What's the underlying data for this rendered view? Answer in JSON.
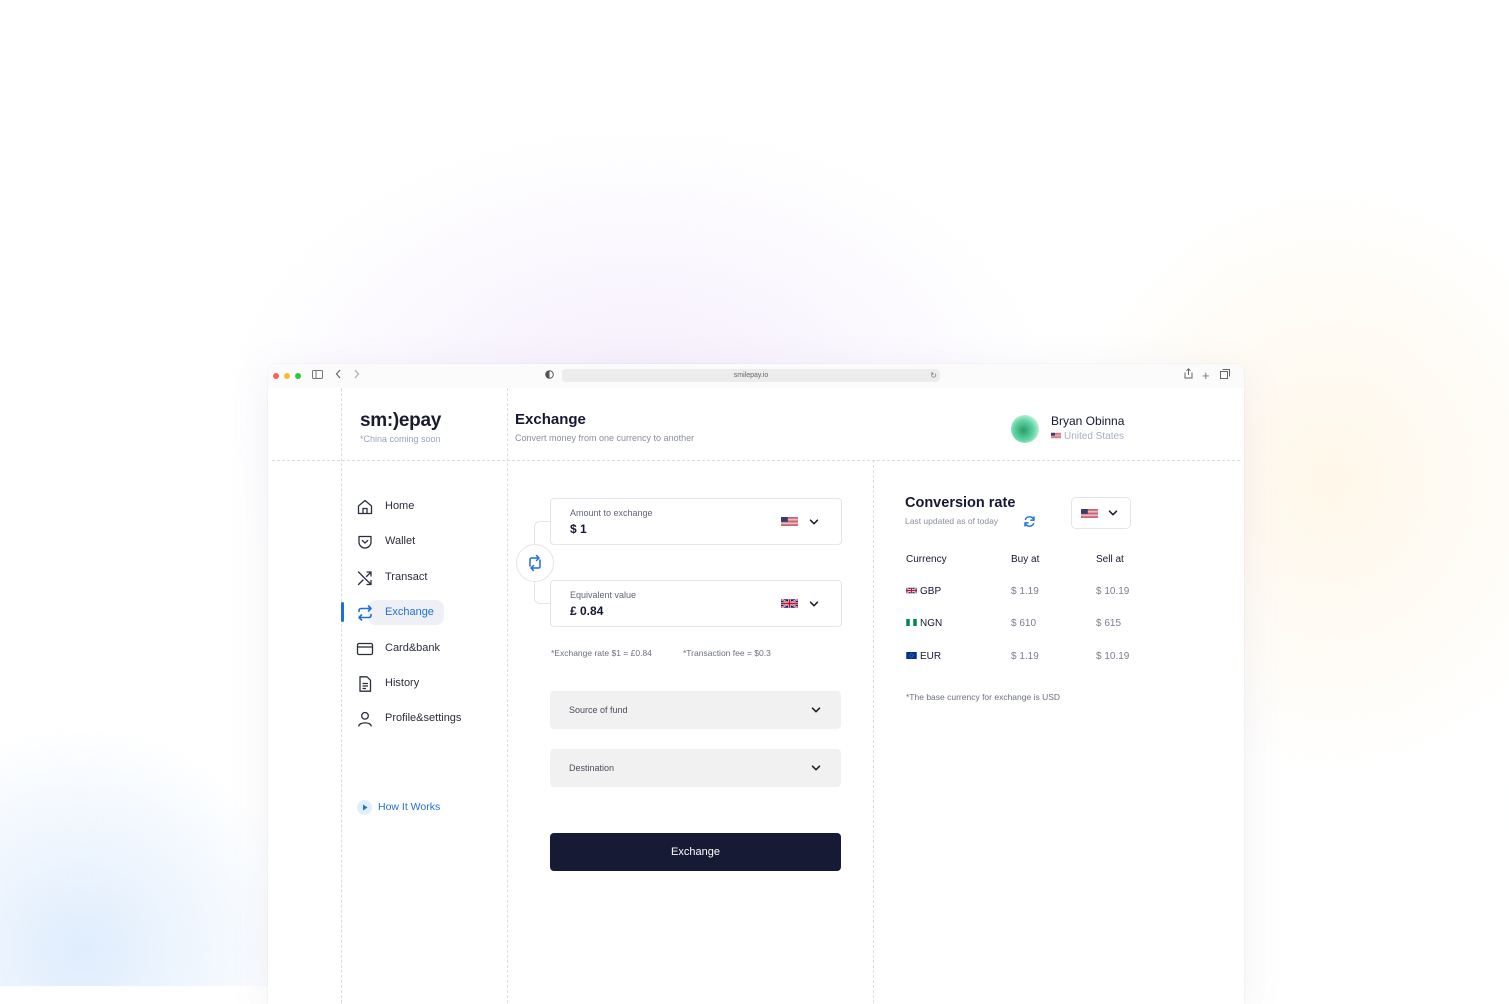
{
  "browser": {
    "url": "smilepay.io"
  },
  "brand": {
    "logo": "sm:)epay",
    "tagline": "*China coming soon"
  },
  "header": {
    "title": "Exchange",
    "subtitle": "Convert money from one currency to another"
  },
  "user": {
    "name": "Bryan Obinna",
    "country": "United States"
  },
  "nav": {
    "items": [
      {
        "label": "Home",
        "icon": "home-icon"
      },
      {
        "label": "Wallet",
        "icon": "wallet-icon"
      },
      {
        "label": "Transact",
        "icon": "shuffle-icon"
      },
      {
        "label": "Exchange",
        "icon": "exchange-icon",
        "active": true
      },
      {
        "label": "Card&bank",
        "icon": "card-icon"
      },
      {
        "label": "History",
        "icon": "document-icon"
      },
      {
        "label": "Profile&settings",
        "icon": "user-icon"
      }
    ],
    "how_it_works": "How It Works"
  },
  "exchange": {
    "amount_label": "Amount to exchange",
    "amount_value": "$ 1",
    "amount_currency_flag": "us-flag",
    "equivalent_label": "Equivalent value",
    "equivalent_value": "£ 0.84",
    "equivalent_currency_flag": "uk-flag",
    "rate_note": "*Exchange rate $1 = £0.84",
    "fee_note": "*Transaction fee = $0.3",
    "source_placeholder": "Source of fund",
    "destination_placeholder": "Destination",
    "submit_label": "Exchange"
  },
  "conversion": {
    "title": "Conversion rate",
    "subtitle": "Last updated as of today",
    "base_flag": "us-flag",
    "columns": [
      "Currency",
      "Buy at",
      "Sell at"
    ],
    "rows": [
      {
        "currency": "GBP",
        "flag": "uk-flag",
        "buy": "$ 1.19",
        "sell": "$ 10.19"
      },
      {
        "currency": "NGN",
        "flag": "ng-flag",
        "buy": "$ 610",
        "sell": "$ 615"
      },
      {
        "currency": "EUR",
        "flag": "eu-flag",
        "buy": "$ 1.19",
        "sell": "$ 10.19"
      }
    ],
    "footnote": "*The base currency for exchange is USD"
  },
  "colors": {
    "accent": "#1f6fd6",
    "primary_button": "#171a35",
    "text_dark": "#151833"
  }
}
